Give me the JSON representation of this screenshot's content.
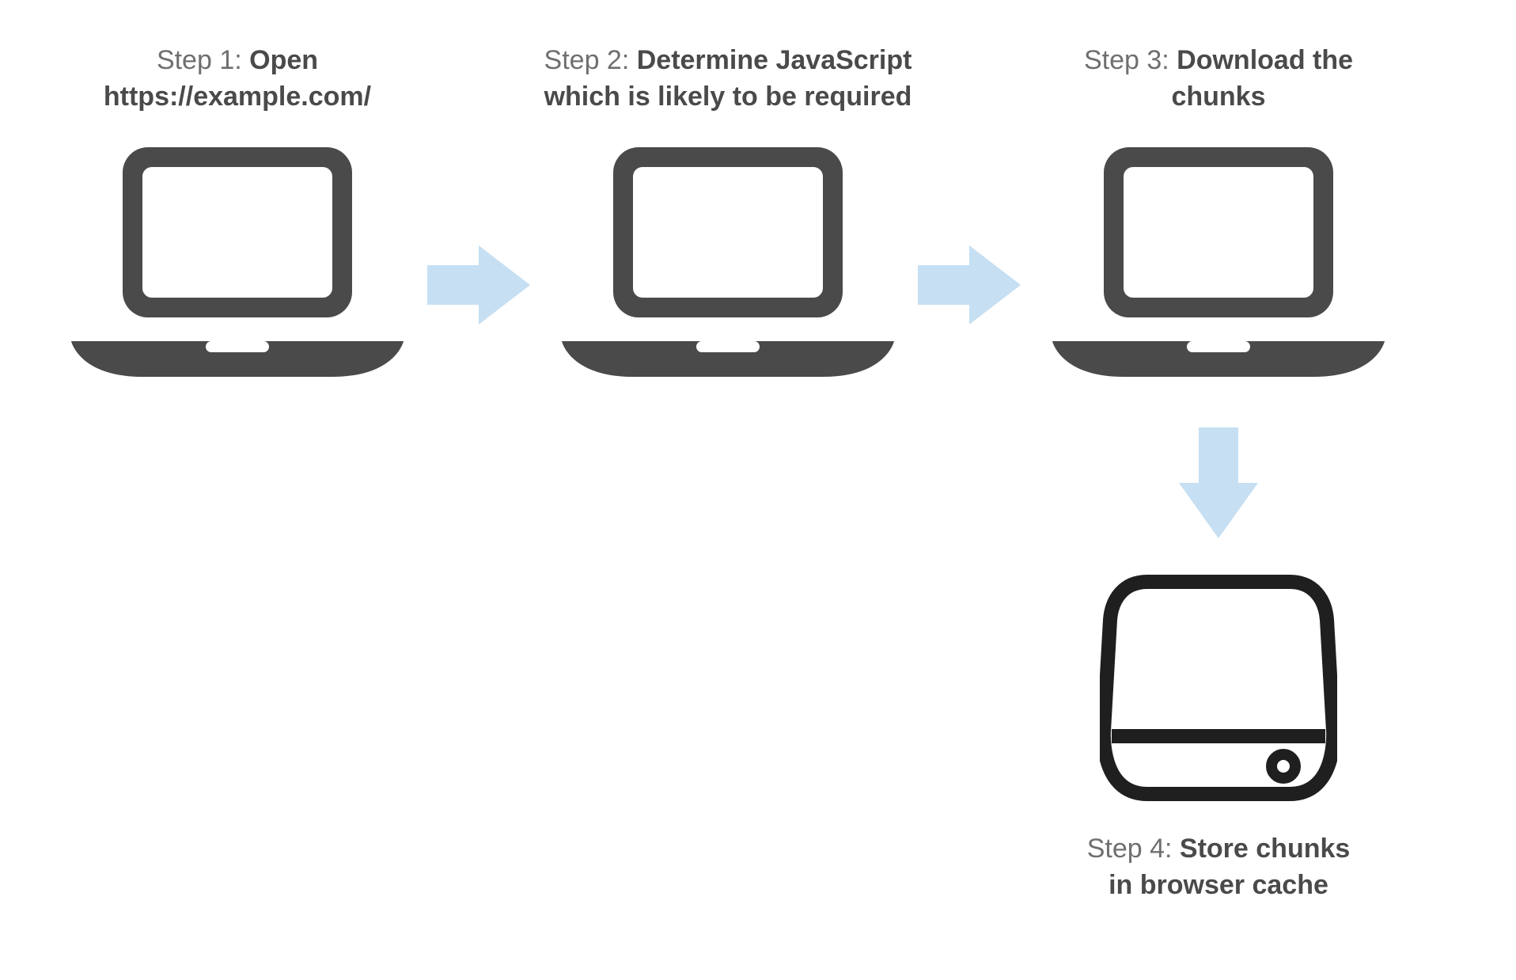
{
  "steps": [
    {
      "prefix": "Step 1: ",
      "title_line1": "Open",
      "title_line2": "https://example.com/"
    },
    {
      "prefix": "Step 2: ",
      "title_line1": "Determine JavaScript",
      "title_line2": "which is likely to be required"
    },
    {
      "prefix": "Step 3: ",
      "title_line1": "Download the",
      "title_line2": "chunks"
    },
    {
      "prefix": "Step 4: ",
      "title_line1": "Store chunks",
      "title_line2": "in browser cache"
    }
  ],
  "colors": {
    "icon_dark": "#4a4a4a",
    "arrow_blue": "#c6dff2",
    "disk_stroke": "#1f1f1f",
    "text_light": "#6f6f6f"
  }
}
